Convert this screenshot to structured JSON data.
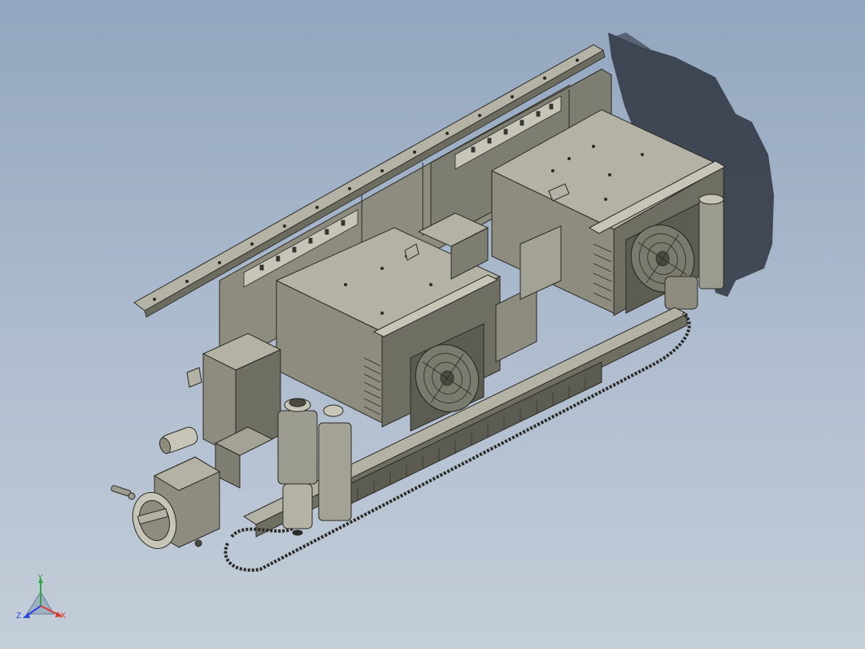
{
  "viewport": {
    "background_top": "#93a6bf",
    "background_bottom": "#c4ced9"
  },
  "model": {
    "description_colors": {
      "body": "#8d8c7e",
      "body_light": "#b4b3a6",
      "body_dark": "#5d5c52",
      "edge": "#2b2b26",
      "shadow": "#2f3540"
    }
  },
  "triad": {
    "x_label": "X",
    "y_label": "Y",
    "z_label": "Z",
    "x_color": "#d83a2a",
    "y_color": "#2fa83a",
    "z_color": "#2a47d8"
  }
}
